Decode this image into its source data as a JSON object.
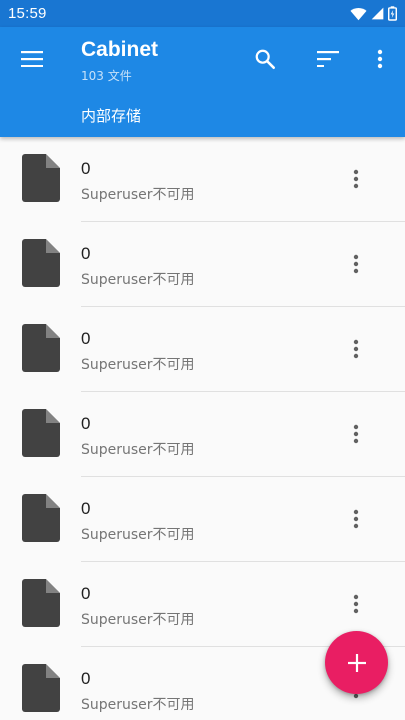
{
  "status_bar": {
    "time": "15:59",
    "icons": [
      "wifi-icon",
      "signal-icon",
      "battery-icon"
    ]
  },
  "app_bar": {
    "title": "Cabinet",
    "subtitle": "103 文件",
    "breadcrumb": "内部存储",
    "actions": [
      "menu-icon",
      "search-icon",
      "sort-icon",
      "more-vert-icon"
    ]
  },
  "files": [
    {
      "name": "0",
      "description": "Superuser不可用"
    },
    {
      "name": "0",
      "description": "Superuser不可用"
    },
    {
      "name": "0",
      "description": "Superuser不可用"
    },
    {
      "name": "0",
      "description": "Superuser不可用"
    },
    {
      "name": "0",
      "description": "Superuser不可用"
    },
    {
      "name": "0",
      "description": "Superuser不可用"
    },
    {
      "name": "0",
      "description": "Superuser不可用"
    }
  ],
  "fab": {
    "icon": "add-icon"
  },
  "colors": {
    "status_bar": "#1976d2",
    "app_bar": "#1e88e5",
    "fab": "#e91e63",
    "file_icon": "#424242"
  }
}
